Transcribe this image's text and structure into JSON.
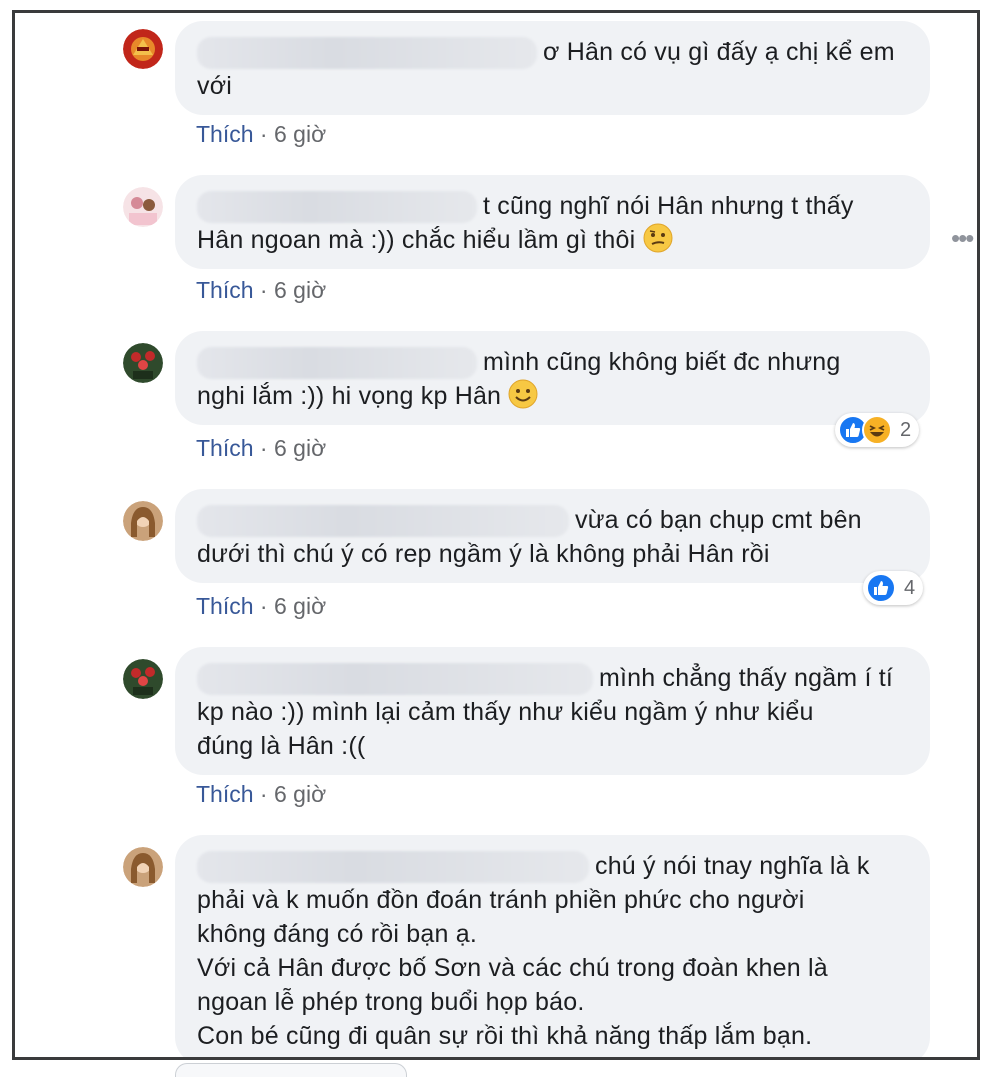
{
  "comments": [
    {
      "text_line1": "ơ Hân có vụ gì đấy ạ chị kể em",
      "text_rest": [
        "với"
      ],
      "like_label": "Thích",
      "time": "6 giờ"
    },
    {
      "text_line1": "t cũng nghĩ nói Hân nhưng t thấy",
      "text_rest": [
        "Hân ngoan mà :)) chắc hiểu lầm gì thôi"
      ],
      "like_label": "Thích",
      "time": "6 giờ",
      "emoji": "confused-face"
    },
    {
      "text_line1": "mình cũng không biết đc nhưng",
      "text_rest": [
        "nghi lắm :)) hi vọng kp Hân"
      ],
      "like_label": "Thích",
      "time": "6 giờ",
      "emoji": "smiling-face",
      "reactions": {
        "types": [
          "like",
          "haha"
        ],
        "count": "2"
      }
    },
    {
      "text_line1": "vừa có bạn chụp cmt bên",
      "text_rest": [
        "dưới thì chú ý có rep ngầm ý là không phải Hân rồi"
      ],
      "like_label": "Thích",
      "time": "6 giờ",
      "reactions": {
        "types": [
          "like"
        ],
        "count": "4"
      }
    },
    {
      "text_line1": "mình chẳng thấy ngầm í tí",
      "text_rest": [
        "kp nào :)) mình lại cảm thấy như kiểu ngầm ý như kiểu",
        "đúng là Hân :(("
      ],
      "like_label": "Thích",
      "time": "6 giờ"
    },
    {
      "text_line1": "chú ý nói tnay nghĩa là k",
      "text_rest": [
        "phải và k muốn đồn đoán tránh phiền phức cho người",
        "không đáng có rồi bạn ạ.",
        "Với cả Hân được bố Sơn và các chú trong đoàn khen là",
        "ngoan lễ phép trong buổi họp báo.",
        "Con bé cũng đi quân sự rồi thì khả năng thấp lắm bạn."
      ]
    }
  ],
  "more_icon": "more-horizontal-icon",
  "colors": {
    "bubble": "#f0f2f5",
    "like_link": "#385898",
    "meta": "#65676b",
    "reaction_like": "#1877f2",
    "reaction_haha": "#f7b125"
  }
}
